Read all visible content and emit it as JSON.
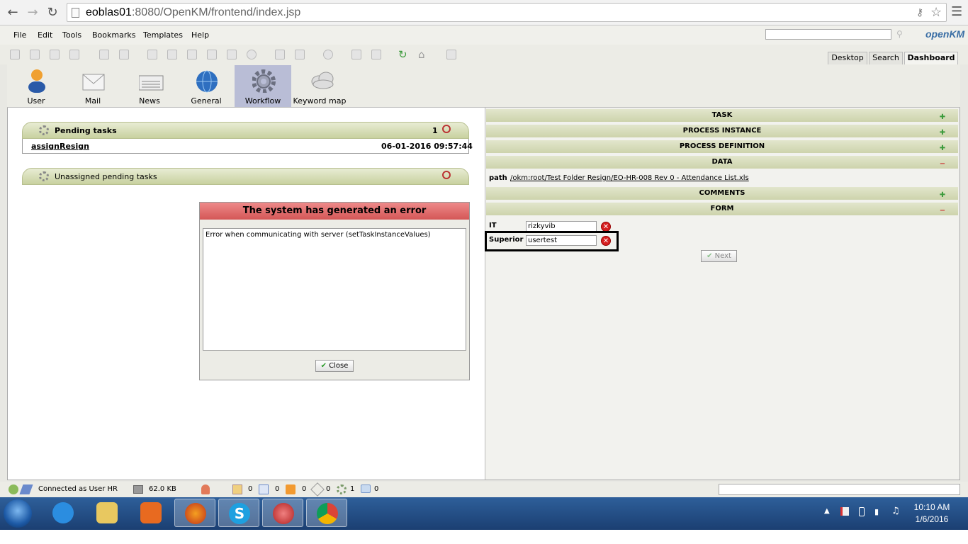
{
  "browser": {
    "url_host": "eoblas01",
    "url_rest": ":8080/OpenKM/frontend/index.jsp"
  },
  "menu": [
    "File",
    "Edit",
    "Tools",
    "Bookmarks",
    "Templates",
    "Help"
  ],
  "logo": "openKM",
  "workspace_tabs": [
    {
      "label": "Desktop",
      "active": false
    },
    {
      "label": "Search",
      "active": false
    },
    {
      "label": "Dashboard",
      "active": true
    }
  ],
  "dashboard_tools": [
    {
      "label": "User",
      "icon": "user-icon",
      "active": false
    },
    {
      "label": "Mail",
      "icon": "mail-icon",
      "active": false
    },
    {
      "label": "News",
      "icon": "news-icon",
      "active": false
    },
    {
      "label": "General",
      "icon": "globe-icon",
      "active": false
    },
    {
      "label": "Workflow",
      "icon": "gear-icon",
      "active": true
    },
    {
      "label": "Keyword map",
      "icon": "cloud-icon",
      "active": false
    }
  ],
  "pending_tasks": {
    "title": "Pending tasks",
    "count": "1",
    "rows": [
      {
        "name": "assignResign",
        "date": "06-01-2016 09:57:44"
      }
    ]
  },
  "unassigned_tasks": {
    "title": "Unassigned pending tasks"
  },
  "error_dialog": {
    "title": "The system has generated an error",
    "message": "Error when communicating with server (setTaskInstanceValues)",
    "close_label": "Close"
  },
  "right_sections": {
    "task": "TASK",
    "process_instance": "PROCESS INSTANCE",
    "process_definition": "PROCESS DEFINITION",
    "data": "DATA",
    "comments": "COMMENTS",
    "form": "FORM"
  },
  "data_path": {
    "label": "path",
    "value": "/okm:root/Test Folder Resign/EO-HR-008 Rev 0 - Attendance List.xls"
  },
  "form": {
    "fields": [
      {
        "label": "IT",
        "value": "rizkyvib"
      },
      {
        "label": "Superior",
        "value": "usertest"
      }
    ],
    "next_label": "Next"
  },
  "status": {
    "connected": "Connected as User HR",
    "size": "62.0 KB",
    "locked": "0",
    "checkout": "0",
    "mail": "0",
    "subscribed": "0",
    "workflow": "1",
    "keywords": "0"
  },
  "taskbar": {
    "time": "10:10 AM",
    "date": "1/6/2016"
  },
  "colors": {
    "panel_green": "#c8d19f",
    "error_red": "#d45656",
    "active_tool": "#b9bdd6",
    "taskbar": "#1b3f72"
  }
}
